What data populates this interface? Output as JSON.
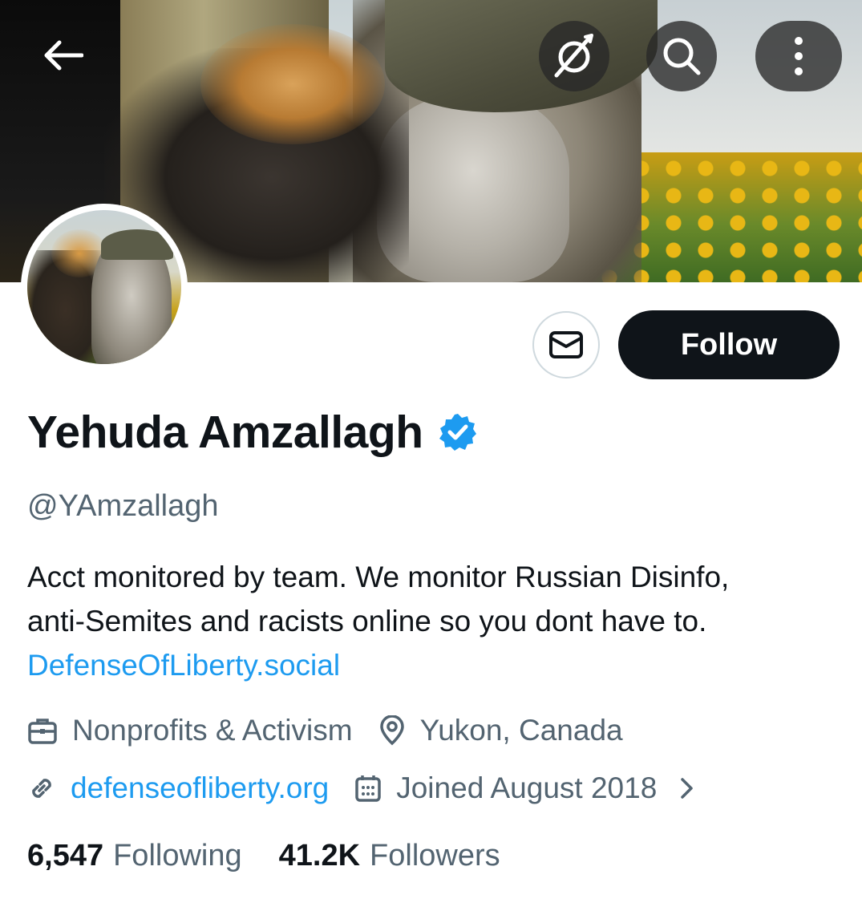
{
  "header": {
    "back_icon": "arrow-left-icon",
    "grok_icon": "grok-icon",
    "search_icon": "search-icon",
    "more_icon": "more-vertical-icon"
  },
  "profile": {
    "display_name": "Yehuda Amzallagh",
    "verified": true,
    "verified_color": "#1d9bf0",
    "handle": "@YAmzallagh",
    "bio_line_1": "Acct monitored by team. We monitor Russian Disinfo,",
    "bio_line_2": "anti-Semites and racists online so you dont have to.",
    "bio_link": "DefenseOfLiberty.social",
    "category": "Nonprofits & Activism",
    "location": "Yukon, Canada",
    "website": "defenseofliberty.org",
    "joined": "Joined August 2018"
  },
  "actions": {
    "message_icon": "envelope-icon",
    "follow_label": "Follow"
  },
  "stats": {
    "following_count": "6,547",
    "following_label": "Following",
    "followers_count": "41.2K",
    "followers_label": "Followers"
  },
  "colors": {
    "text_primary": "#0f1419",
    "text_secondary": "#536471",
    "link": "#1d9bf0",
    "follow_bg": "#0f1419"
  }
}
